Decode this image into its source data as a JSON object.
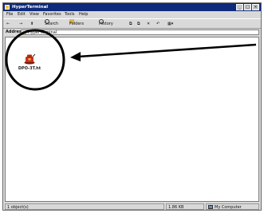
{
  "window": {
    "title": "HyperTerminal"
  },
  "menubar": {
    "items": [
      "File",
      "Edit",
      "View",
      "Favorites",
      "Tools",
      "Help"
    ]
  },
  "toolbar": {
    "back_label": "←",
    "forward_label": "→",
    "up_label": "⬆",
    "search_label": "Search",
    "folders_label": "Folders",
    "history_label": "History"
  },
  "addressbar": {
    "label": "Address",
    "value": "HyperTerminal"
  },
  "content": {
    "file_name": "DPO-3T.ht"
  },
  "statusbar": {
    "left": "1 object(s)",
    "size": "1.86 KB",
    "location": "My Computer"
  },
  "colors": {
    "titlebar": "#0f2a7a",
    "annotation": "#000000"
  }
}
